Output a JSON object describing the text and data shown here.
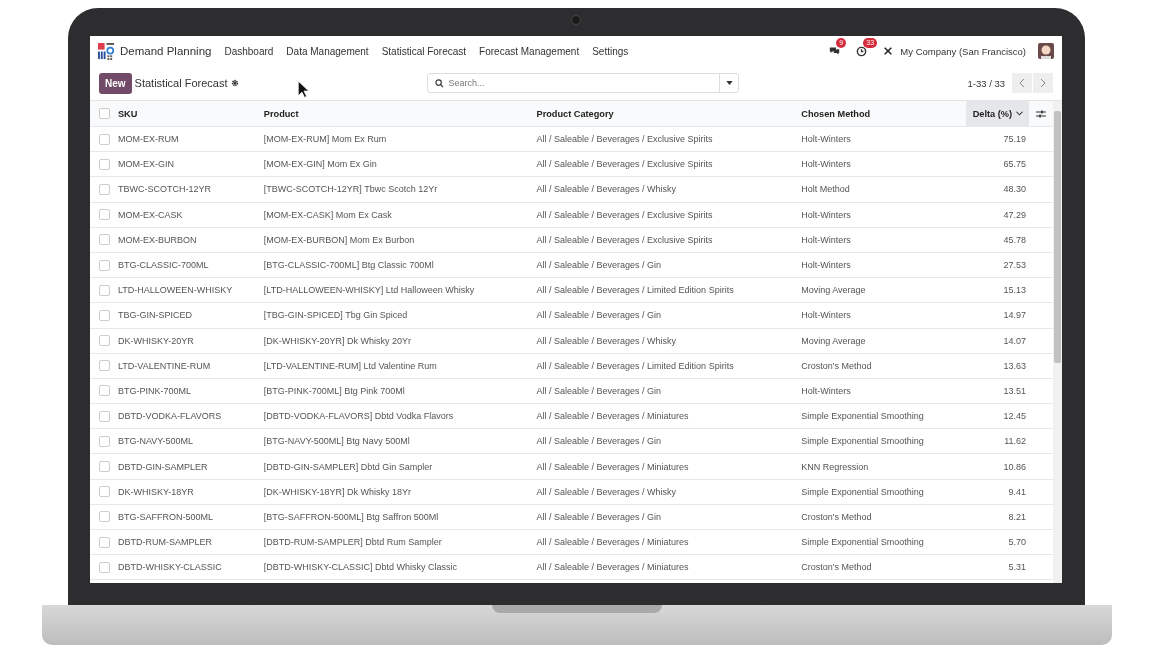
{
  "navbar": {
    "app_name": "Demand Planning",
    "menu": [
      "Dashboard",
      "Data Management",
      "Statistical Forecast",
      "Forecast Management",
      "Settings"
    ],
    "messages_badge": "9",
    "activities_badge": "33",
    "company": "My Company (San Francisco)"
  },
  "control_panel": {
    "new_button": "New",
    "breadcrumb": "Statistical Forecast",
    "search": {
      "placeholder": "Search..."
    },
    "pager": "1-33 / 33"
  },
  "table": {
    "all_checked": false,
    "columns": [
      {
        "label": "SKU",
        "sorted": false
      },
      {
        "label": "Product",
        "sorted": false
      },
      {
        "label": "Product Category",
        "sorted": false
      },
      {
        "label": "Chosen Method",
        "sorted": false
      },
      {
        "label": "Delta (%)",
        "sorted": true
      }
    ],
    "rows": [
      {
        "checked": false,
        "cells": [
          "MOM-EX-RUM",
          "[MOM-EX-RUM] Mom Ex Rum",
          "All / Saleable / Beverages / Exclusive Spirits",
          "Holt-Winters",
          "75.19"
        ]
      },
      {
        "checked": false,
        "cells": [
          "MOM-EX-GIN",
          "[MOM-EX-GIN] Mom Ex Gin",
          "All / Saleable / Beverages / Exclusive Spirits",
          "Holt-Winters",
          "65.75"
        ]
      },
      {
        "checked": false,
        "cells": [
          "TBWC-SCOTCH-12YR",
          "[TBWC-SCOTCH-12YR] Tbwc Scotch 12Yr",
          "All / Saleable / Beverages / Whisky",
          "Holt Method",
          "48.30"
        ]
      },
      {
        "checked": false,
        "cells": [
          "MOM-EX-CASK",
          "[MOM-EX-CASK] Mom Ex Cask",
          "All / Saleable / Beverages / Exclusive Spirits",
          "Holt-Winters",
          "47.29"
        ]
      },
      {
        "checked": false,
        "cells": [
          "MOM-EX-BURBON",
          "[MOM-EX-BURBON] Mom Ex Burbon",
          "All / Saleable / Beverages / Exclusive Spirits",
          "Holt-Winters",
          "45.78"
        ]
      },
      {
        "checked": false,
        "cells": [
          "BTG-CLASSIC-700ML",
          "[BTG-CLASSIC-700ML] Btg Classic 700Ml",
          "All / Saleable / Beverages / Gin",
          "Holt-Winters",
          "27.53"
        ]
      },
      {
        "checked": false,
        "cells": [
          "LTD-HALLOWEEN-WHISKY",
          "[LTD-HALLOWEEN-WHISKY] Ltd Halloween Whisky",
          "All / Saleable / Beverages / Limited Edition Spirits",
          "Moving Average",
          "15.13"
        ]
      },
      {
        "checked": false,
        "cells": [
          "TBG-GIN-SPICED",
          "[TBG-GIN-SPICED] Tbg Gin Spiced",
          "All / Saleable / Beverages / Gin",
          "Holt-Winters",
          "14.97"
        ]
      },
      {
        "checked": false,
        "cells": [
          "DK-WHISKY-20YR",
          "[DK-WHISKY-20YR] Dk Whisky 20Yr",
          "All / Saleable / Beverages / Whisky",
          "Moving Average",
          "14.07"
        ]
      },
      {
        "checked": false,
        "cells": [
          "LTD-VALENTINE-RUM",
          "[LTD-VALENTINE-RUM] Ltd Valentine Rum",
          "All / Saleable / Beverages / Limited Edition Spirits",
          "Croston's Method",
          "13.63"
        ]
      },
      {
        "checked": false,
        "cells": [
          "BTG-PINK-700ML",
          "[BTG-PINK-700ML] Btg Pink 700Ml",
          "All / Saleable / Beverages / Gin",
          "Holt-Winters",
          "13.51"
        ]
      },
      {
        "checked": false,
        "cells": [
          "DBTD-VODKA-FLAVORS",
          "[DBTD-VODKA-FLAVORS] Dbtd Vodka Flavors",
          "All / Saleable / Beverages / Miniatures",
          "Simple Exponential Smoothing",
          "12.45"
        ]
      },
      {
        "checked": false,
        "cells": [
          "BTG-NAVY-500ML",
          "[BTG-NAVY-500ML] Btg Navy 500Ml",
          "All / Saleable / Beverages / Gin",
          "Simple Exponential Smoothing",
          "11.62"
        ]
      },
      {
        "checked": false,
        "cells": [
          "DBTD-GIN-SAMPLER",
          "[DBTD-GIN-SAMPLER] Dbtd Gin Sampler",
          "All / Saleable / Beverages / Miniatures",
          "KNN Regression",
          "10.86"
        ]
      },
      {
        "checked": false,
        "cells": [
          "DK-WHISKY-18YR",
          "[DK-WHISKY-18YR] Dk Whisky 18Yr",
          "All / Saleable / Beverages / Whisky",
          "Simple Exponential Smoothing",
          "9.41"
        ]
      },
      {
        "checked": false,
        "cells": [
          "BTG-SAFFRON-500ML",
          "[BTG-SAFFRON-500ML] Btg Saffron 500Ml",
          "All / Saleable / Beverages / Gin",
          "Croston's Method",
          "8.21"
        ]
      },
      {
        "checked": false,
        "cells": [
          "DBTD-RUM-SAMPLER",
          "[DBTD-RUM-SAMPLER] Dbtd Rum Sampler",
          "All / Saleable / Beverages / Miniatures",
          "Simple Exponential Smoothing",
          "5.70"
        ]
      },
      {
        "checked": false,
        "cells": [
          "DBTD-WHISKY-CLASSIC",
          "[DBTD-WHISKY-CLASSIC] Dbtd Whisky Classic",
          "All / Saleable / Beverages / Miniatures",
          "Croston's Method",
          "5.31"
        ]
      }
    ]
  }
}
